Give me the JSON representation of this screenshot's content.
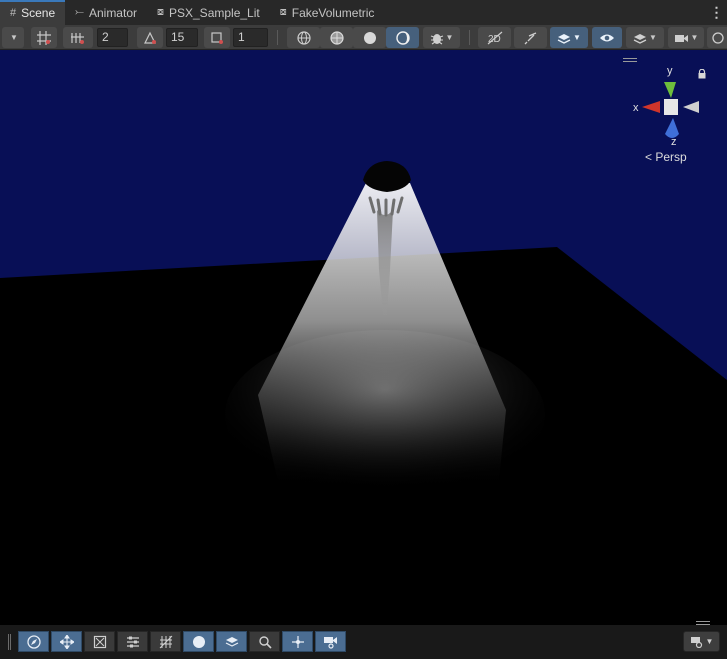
{
  "tabs": [
    {
      "label": "Scene",
      "icon": "grid-icon",
      "active": true
    },
    {
      "label": "Animator",
      "icon": "animator-icon",
      "active": false
    },
    {
      "label": "PSX_Sample_Lit",
      "icon": "shader-graph-icon",
      "active": false
    },
    {
      "label": "FakeVolumetric",
      "icon": "shader-graph-icon",
      "active": false
    }
  ],
  "toolbar": {
    "grid_snap_value": "2",
    "rotation_snap_value": "15",
    "scale_snap_value": "1"
  },
  "viewport": {
    "background_color": "#080f56",
    "floor_color": "#000000",
    "light_color": "#ffffff"
  },
  "gizmo": {
    "y_label": "y",
    "x_label": "x",
    "z_label": "z",
    "projection_label": "Persp",
    "x_color": "#d0352b",
    "y_color": "#6ebe3c",
    "z_color": "#3f6fd8"
  }
}
